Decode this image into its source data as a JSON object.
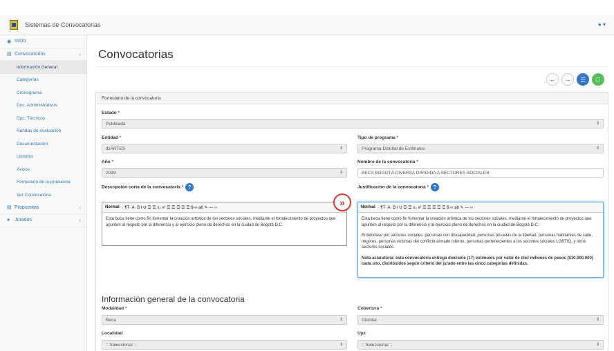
{
  "app": {
    "title": "Sistemas de Convocatorias",
    "user_icon": "user-icon"
  },
  "sidebar": {
    "items": [
      {
        "label": "Inicio",
        "icon": "dashboard-icon"
      },
      {
        "label": "Convocatorias",
        "icon": "list-icon"
      },
      {
        "label": "Propuestas",
        "icon": "file-icon"
      },
      {
        "label": "Jurados",
        "icon": "users-icon"
      }
    ],
    "subitems": [
      "Información General",
      "Categorías",
      "Cronograma",
      "Doc. Administrativos",
      "Doc. Técnicos",
      "Rondas de evaluación",
      "Documentación",
      "Listados",
      "Avisos",
      "Formulario de la propuesta",
      "Ver Convocatoria"
    ]
  },
  "page": {
    "title": "Convocatorias",
    "panel_title": "Formulario de la convocatoria",
    "section_title": "Información general de la convocatoria"
  },
  "form": {
    "estado": {
      "label": "Estado",
      "value": "Publicada"
    },
    "entidad": {
      "label": "Entidad",
      "value": "IDARTES"
    },
    "tipo_programa": {
      "label": "Tipo de programa",
      "value": "Programa Distrital de Estímulos"
    },
    "anio": {
      "label": "Año",
      "value": "2019"
    },
    "nombre": {
      "label": "Nombre de la convocatoria",
      "value": "BECA BOGOTÁ DIVERSA DIRIGIDA A SECTORES SOCIALES"
    },
    "descripcion": {
      "label": "Descripción corta de la convocatoria",
      "text": "Esta beca tiene como fin fomentar la creación artística de los sectores sociales, mediante el fortalecimiento de proyectos que apunten al respeto por la diferencia y al ejercicio pleno de derechos en la ciudad de Bogotá D.C."
    },
    "justificacion": {
      "label": "Justificación de la convocatoria",
      "p1": "Esta beca tiene como fin fomentar la creación artística de los sectores sociales, mediante el fortalecimiento de proyectos que apunten al respeto por la diferencia y al ejercicio pleno de derechos en la ciudad de Bogotá D.C.",
      "p2": "Entiéndase por sectores sociales: personas con discapacidad, personas privadas de la libertad, personas habitantes de calle, mujeres, personas víctimas del conflicto armado interno, personas pertenecientes a los sectores sociales LGBTIQ, y otros sectores sociales.",
      "p3": "Nota aclaratoria: esta convocatoria entrega dieciséte (17) estímulos por valor de diez millones de pesos ($10.000.000) cada uno, distribuidos según criterio del jurado entre las cinco categorías definidas."
    },
    "modalidad": {
      "label": "Modalidad",
      "value": "Beca"
    },
    "cobertura": {
      "label": "Cobertura",
      "value": "Distrital"
    },
    "localidad": {
      "label": "Localidad",
      "value": ":: Seleccionar ::"
    },
    "upz": {
      "label": "Upz",
      "value": ":: Seleccionar ::"
    },
    "required_mark": "*"
  },
  "editor_toolbar": {
    "format": "Normal",
    "buttons": "· ¶T· A· B I U ☰ ☰ x₂ x² ☰ ☰ ☰ ☰ ☰ $ ∞ ab ✎ — ‹›"
  },
  "colors": {
    "accent": "#337ab7",
    "blue_btn": "#2f77c4",
    "green_btn": "#58bd5b",
    "marker": "#dd3333"
  }
}
